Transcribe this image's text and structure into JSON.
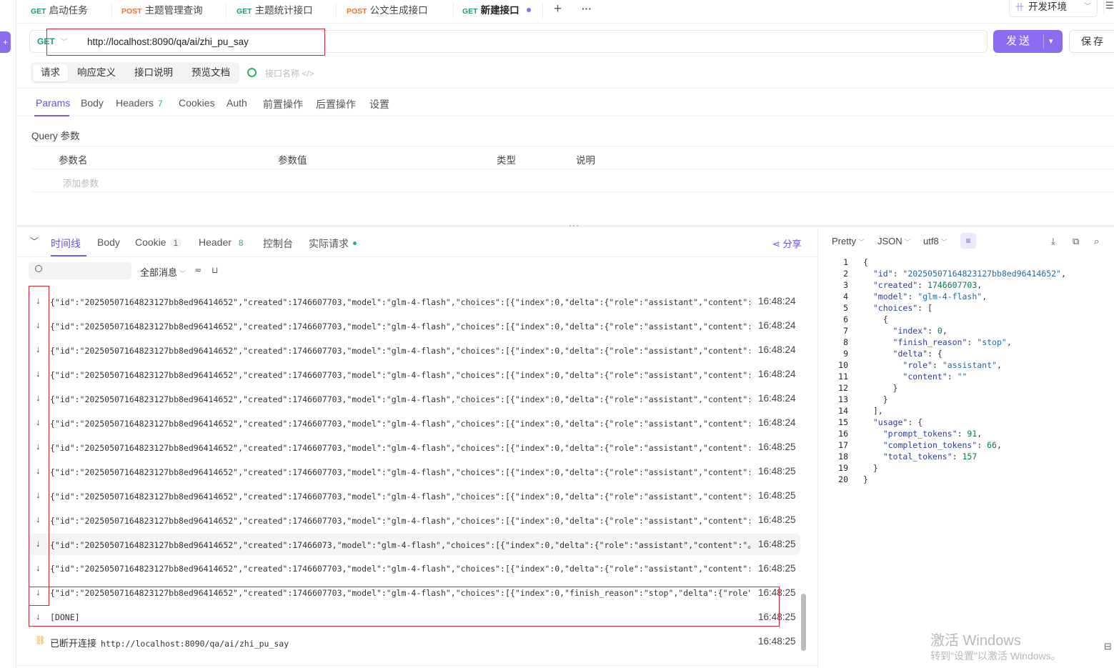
{
  "tabs": [
    {
      "method": "GET",
      "label": "启动任务"
    },
    {
      "method": "POST",
      "label": "主题管理查询"
    },
    {
      "method": "GET",
      "label": "主题统计接口"
    },
    {
      "method": "POST",
      "label": "公文生成接口"
    },
    {
      "method": "GET",
      "label": "新建接口"
    }
  ],
  "tab_add": "+",
  "tab_more": "···",
  "environment": "开发环境",
  "request": {
    "method": "GET",
    "url": "http://localhost:8090/qa/ai/zhi_pu_say",
    "send_label": "发送",
    "save_label": "保存"
  },
  "sub_tabs": [
    "请求",
    "响应定义",
    "接口说明",
    "预览文档"
  ],
  "api_name_placeholder": "接口名称 </>",
  "param_tabs": [
    {
      "label": "Params",
      "count": ""
    },
    {
      "label": "Body",
      "count": ""
    },
    {
      "label": "Headers",
      "count": "7"
    },
    {
      "label": "Cookies",
      "count": ""
    },
    {
      "label": "Auth",
      "count": ""
    },
    {
      "label": "前置操作",
      "count": ""
    },
    {
      "label": "后置操作",
      "count": ""
    },
    {
      "label": "设置",
      "count": ""
    }
  ],
  "query": {
    "title": "Query 参数",
    "headers": [
      "参数名",
      "参数值",
      "类型",
      "说明"
    ],
    "add_placeholder": "添加参数"
  },
  "splitter_grip": "···",
  "response_tabs": [
    {
      "label": "时间线",
      "count": ""
    },
    {
      "label": "Body",
      "count": ""
    },
    {
      "label": "Cookie",
      "count": "1"
    },
    {
      "label": "Header",
      "count": "8"
    },
    {
      "label": "控制台",
      "count": ""
    },
    {
      "label": "实际请求",
      "count": ""
    }
  ],
  "share_label": "分享",
  "filter_label": "全部消息",
  "events": [
    {
      "text": "{\"id\":\"20250507164823127bb8ed96414652\",\"created\":1746607703,\"model\":\"glm-4-flash\",\"choices\":[{\"index\":0,\"delta\":{\"role\":\"assistant\",\"content\":\"或者…",
      "time": "16:48:24"
    },
    {
      "text": "{\"id\":\"20250507164823127bb8ed96414652\",\"created\":1746607703,\"model\":\"glm-4-flash\",\"choices\":[{\"index\":0,\"delta\":{\"role\":\"assistant\",\"content\":\"查阅…",
      "time": "16:48:24"
    },
    {
      "text": "{\"id\":\"20250507164823127bb8ed96414652\",\"created\":1746607703,\"model\":\"glm-4-flash\",\"choices\":[{\"index\":0,\"delta\":{\"role\":\"assistant\",\"content\":\"相关…",
      "time": "16:48:24"
    },
    {
      "text": "{\"id\":\"20250507164823127bb8ed96414652\",\"created\":1746607703,\"model\":\"glm-4-flash\",\"choices\":[{\"index\":0,\"delta\":{\"role\":\"assistant\",\"content\":\"经济…",
      "time": "16:48:24"
    },
    {
      "text": "{\"id\":\"20250507164823127bb8ed96414652\",\"created\":1746607703,\"model\":\"glm-4-flash\",\"choices\":[{\"index\":0,\"delta\":{\"role\":\"assistant\",\"content\":\"报告…",
      "time": "16:48:24"
    },
    {
      "text": "{\"id\":\"20250507164823127bb8ed96414652\",\"created\":1746607703,\"model\":\"glm-4-flash\",\"choices\":[{\"index\":0,\"delta\":{\"role\":\"assistant\",\"content\":\"来\"}…",
      "time": "16:48:24"
    },
    {
      "text": "{\"id\":\"20250507164823127bb8ed96414652\",\"created\":1746607703,\"model\":\"glm-4-flash\",\"choices\":[{\"index\":0,\"delta\":{\"role\":\"assistant\",\"content\":\"获取…",
      "time": "16:48:25"
    },
    {
      "text": "{\"id\":\"20250507164823127bb8ed96414652\",\"created\":1746607703,\"model\":\"glm-4-flash\",\"choices\":[{\"index\":0,\"delta\":{\"role\":\"assistant\",\"content\":\"最新…",
      "time": "16:48:25"
    },
    {
      "text": "{\"id\":\"20250507164823127bb8ed96414652\",\"created\":1746607703,\"model\":\"glm-4-flash\",\"choices\":[{\"index\":0,\"delta\":{\"role\":\"assistant\",\"content\":\"详细…",
      "time": "16:48:25"
    },
    {
      "text": "{\"id\":\"20250507164823127bb8ed96414652\",\"created\":1746607703,\"model\":\"glm-4-flash\",\"choices\":[{\"index\":0,\"delta\":{\"role\":\"assistant\",\"content\":\"数据…",
      "time": "16:48:25"
    },
    {
      "text": "{\"id\":\"20250507164823127bb8ed96414652\",\"created\":17466073,\"model\":\"glm-4-flash\",\"choices\":[{\"index\":0,\"delta\":{\"role\":\"assistant\",\"content\":\"。\"}…",
      "time": "16:48:25"
    },
    {
      "text": "{\"id\":\"20250507164823127bb8ed96414652\",\"created\":1746607703,\"model\":\"glm-4-flash\",\"choices\":[{\"index\":0,\"delta\":{\"role\":\"assistant\",\"content\":\"\\\"\\n…",
      "time": "16:48:25"
    },
    {
      "text": "{\"id\":\"20250507164823127bb8ed96414652\",\"created\":1746607703,\"model\":\"glm-4-flash\",\"choices\":[{\"index\":0,\"finish_reason\":\"stop\",\"delta\":{\"role\":\"ass…",
      "time": "16:48:25"
    },
    {
      "text": "[DONE]",
      "time": "16:48:25"
    }
  ],
  "disconnect": {
    "label": "已断开连接",
    "url": "http://localhost:8090/qa/ai/zhi_pu_say",
    "time": "16:48:25"
  },
  "viewer": {
    "format": "Pretty",
    "type": "JSON",
    "encoding": "utf8"
  },
  "code_lines": [
    "{",
    "  \"id\": \"20250507164823127bb8ed96414652\",",
    "  \"created\": 1746607703,",
    "  \"model\": \"glm-4-flash\",",
    "  \"choices\": [",
    "    {",
    "      \"index\": 0,",
    "      \"finish_reason\": \"stop\",",
    "      \"delta\": {",
    "        \"role\": \"assistant\",",
    "        \"content\": \"\"",
    "      }",
    "    }",
    "  ],",
    "  \"usage\": {",
    "    \"prompt_tokens\": 91,",
    "    \"completion_tokens\": 66,",
    "    \"total_tokens\": 157",
    "  }",
    "}"
  ],
  "watermark": {
    "line1": "激活 Windows",
    "line2": "转到\"设置\"以激活 Windows。"
  },
  "colors": {
    "accent": "#8a6cf0",
    "get": "#1a9e6a",
    "post": "#e8742e",
    "annotation": "#d9252b"
  }
}
